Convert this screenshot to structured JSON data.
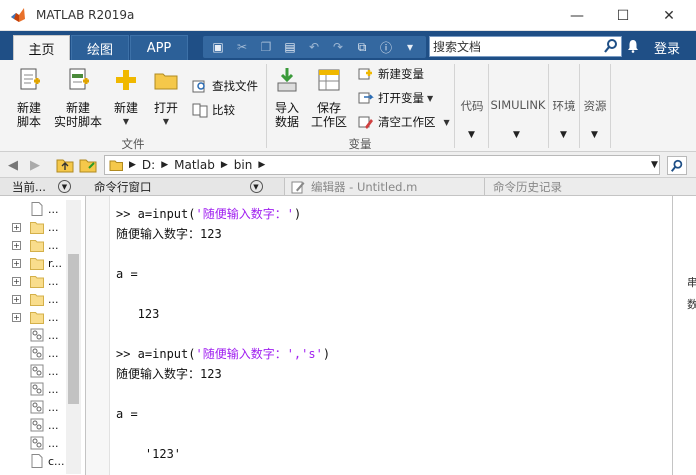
{
  "window": {
    "title": "MATLAB R2019a",
    "controls": {
      "minimize": "—",
      "maximize": "☐",
      "close": "✕"
    }
  },
  "tabs": [
    {
      "label": "主页",
      "active": true
    },
    {
      "label": "绘图",
      "active": false
    },
    {
      "label": "APP",
      "active": false
    }
  ],
  "search": {
    "placeholder": "搜索文档"
  },
  "account": {
    "login_label": "登录"
  },
  "ribbon": {
    "file_group": {
      "label": "文件",
      "new_script": "新建\n脚本",
      "new_live_script": "新建\n实时脚本",
      "new": "新建",
      "open": "打开",
      "find_files": "查找文件",
      "compare": "比较"
    },
    "variable_group": {
      "label": "变量",
      "import_data": "导入\n数据",
      "save_workspace": "保存\n工作区",
      "new_variable": "新建变量",
      "open_variable": "打开变量",
      "clear_workspace": "清空工作区"
    },
    "collapsed_groups": [
      "代码",
      "SIMULINK",
      "环境",
      "资源"
    ]
  },
  "address": {
    "path_segments": [
      "D:",
      "Matlab",
      "bin"
    ]
  },
  "panels": {
    "current_folder": "当前...",
    "command_window": "命令行窗口",
    "editor": "编辑器 - Untitled.m",
    "history": "命令历史记录"
  },
  "folder_items": [
    {
      "name": "...",
      "type": "file",
      "expandable": false
    },
    {
      "name": "...",
      "type": "folder",
      "expandable": true
    },
    {
      "name": "...",
      "type": "folder",
      "expandable": true
    },
    {
      "name": "r...",
      "type": "folder",
      "expandable": true
    },
    {
      "name": "...",
      "type": "folder",
      "expandable": true
    },
    {
      "name": "...",
      "type": "folder",
      "expandable": true
    },
    {
      "name": "...",
      "type": "folder",
      "expandable": true
    },
    {
      "name": "...",
      "type": "dll",
      "expandable": false
    },
    {
      "name": "...",
      "type": "dll",
      "expandable": false
    },
    {
      "name": "...",
      "type": "dll",
      "expandable": false
    },
    {
      "name": "...",
      "type": "dll",
      "expandable": false
    },
    {
      "name": "...",
      "type": "dll",
      "expandable": false
    },
    {
      "name": "...",
      "type": "dll",
      "expandable": false
    },
    {
      "name": "...",
      "type": "dll",
      "expandable": false
    },
    {
      "name": "c...",
      "type": "file",
      "expandable": false
    }
  ],
  "command_window": {
    "prompt": ">>",
    "lines": [
      {
        "kind": "cmd",
        "code": "a=input(",
        "string": "'随便输入数字：'",
        "tail": ")"
      },
      {
        "kind": "out",
        "text": "随便输入数字：123"
      },
      {
        "kind": "out",
        "text": ""
      },
      {
        "kind": "out",
        "text": "a ="
      },
      {
        "kind": "out",
        "text": ""
      },
      {
        "kind": "out",
        "text": "   123"
      },
      {
        "kind": "out",
        "text": ""
      },
      {
        "kind": "cmd",
        "code": "a=input(",
        "string": "'随便输入数字：','s'",
        "tail": ")"
      },
      {
        "kind": "out",
        "text": "随便输入数字：123"
      },
      {
        "kind": "out",
        "text": ""
      },
      {
        "kind": "out",
        "text": "a ="
      },
      {
        "kind": "out",
        "text": ""
      },
      {
        "kind": "out",
        "text": "    '123'"
      }
    ]
  },
  "sliver_text": [
    "串",
    "数"
  ]
}
